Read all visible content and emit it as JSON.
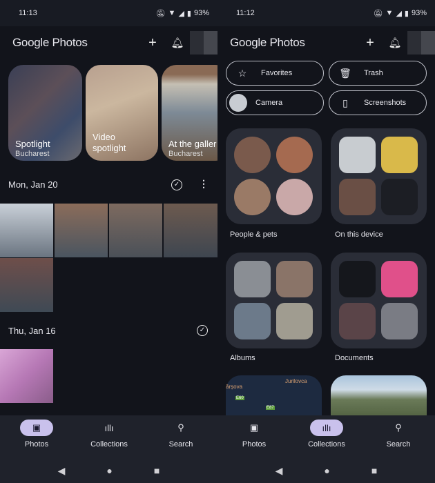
{
  "left": {
    "status": {
      "time": "11:13",
      "battery": "93%"
    },
    "app_title": {
      "google": "Google",
      "photos": "Photos"
    },
    "memories": [
      {
        "title": "Spotlight",
        "subtitle": "Bucharest"
      },
      {
        "title": "Video spotlight",
        "subtitle": ""
      },
      {
        "title": "At the galler",
        "subtitle": "Bucharest"
      }
    ],
    "days": [
      {
        "label": "Mon, Jan 20"
      },
      {
        "label": "Thu, Jan 16"
      }
    ],
    "nav": [
      {
        "label": "Photos",
        "icon": "photo-icon",
        "active": true
      },
      {
        "label": "Collections",
        "icon": "collections-icon",
        "active": false
      },
      {
        "label": "Search",
        "icon": "search-icon",
        "active": false
      }
    ]
  },
  "right": {
    "status": {
      "time": "11:12",
      "battery": "93%"
    },
    "app_title": {
      "google": "Google",
      "photos": "Photos"
    },
    "chips": [
      {
        "label": "Favorites",
        "icon": "star-icon"
      },
      {
        "label": "Trash",
        "icon": "trash-icon"
      },
      {
        "label": "Camera",
        "icon": "camera-thumb"
      },
      {
        "label": "Screenshots",
        "icon": "phone-icon"
      }
    ],
    "collections": [
      {
        "label": "People & pets"
      },
      {
        "label": "On this device"
      },
      {
        "label": "Albums"
      },
      {
        "label": "Documents"
      }
    ],
    "map_labels": [
      "Jurilovca",
      "ărșova",
      "E60",
      "E87"
    ],
    "nav": [
      {
        "label": "Photos",
        "icon": "photo-icon",
        "active": false
      },
      {
        "label": "Collections",
        "icon": "collections-icon",
        "active": true
      },
      {
        "label": "Search",
        "icon": "search-icon",
        "active": false
      }
    ]
  },
  "colors": {
    "bg": "#12141b",
    "nav_bg": "#1f222b",
    "active_pill": "#c9c1ec",
    "card": "#2a2d37"
  }
}
